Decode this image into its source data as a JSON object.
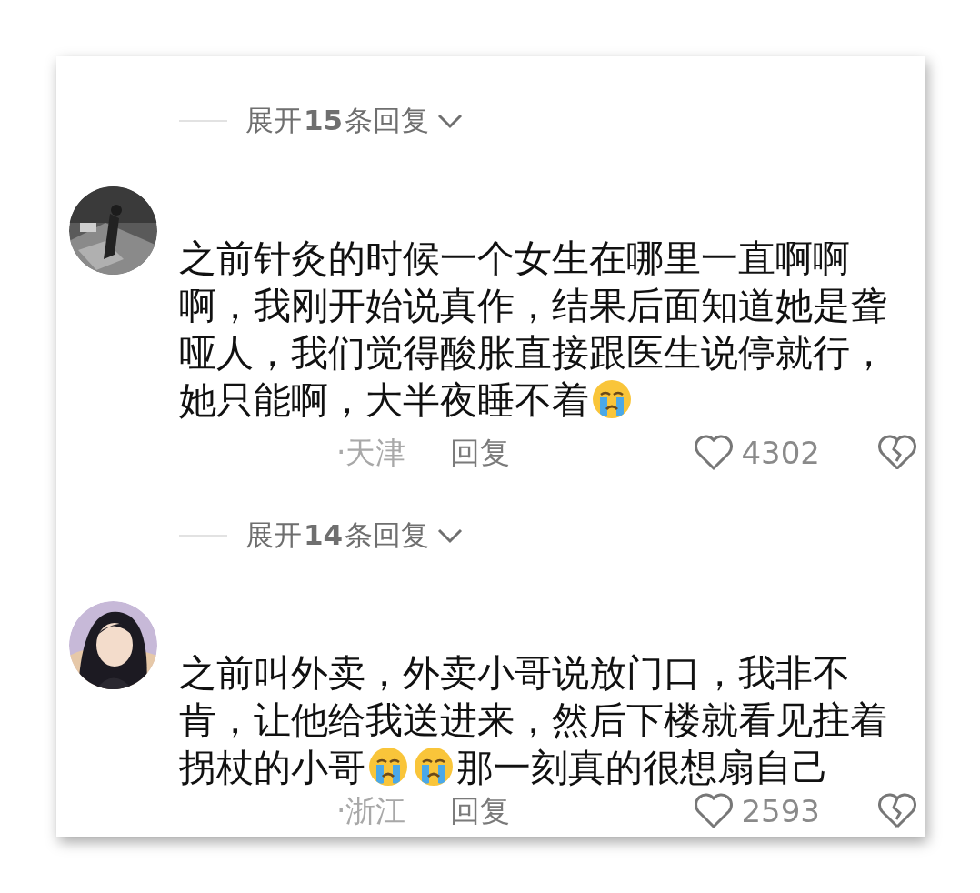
{
  "comments": [
    {
      "replies_label": "展开**15**条回复",
      "text": [
        {
          "kind": "text",
          "text": "之前针灸的时候一个女生在哪里一直啊啊啊，我刚开始说真作，结果后面知道她是聋哑人，我们觉得酸胀直接跟医生说停就行，她只能啊，大半夜睡不着"
        },
        {
          "kind": "emoji"
        }
      ],
      "location": "·天津",
      "reply": "回复",
      "likes": "4302"
    },
    {
      "replies_label": "展开**14**条回复",
      "text": [
        {
          "kind": "text",
          "text": "之前叫外卖，外卖小哥说放门口，我非不肯，让他给我送进来，然后下楼就看见拄着拐杖的小哥"
        },
        {
          "kind": "emoji"
        },
        {
          "kind": "emoji"
        },
        {
          "kind": "text",
          "text": "那一刻真的很想扇自己"
        }
      ],
      "location": "·浙江",
      "reply": "回复",
      "likes": "2593"
    }
  ]
}
